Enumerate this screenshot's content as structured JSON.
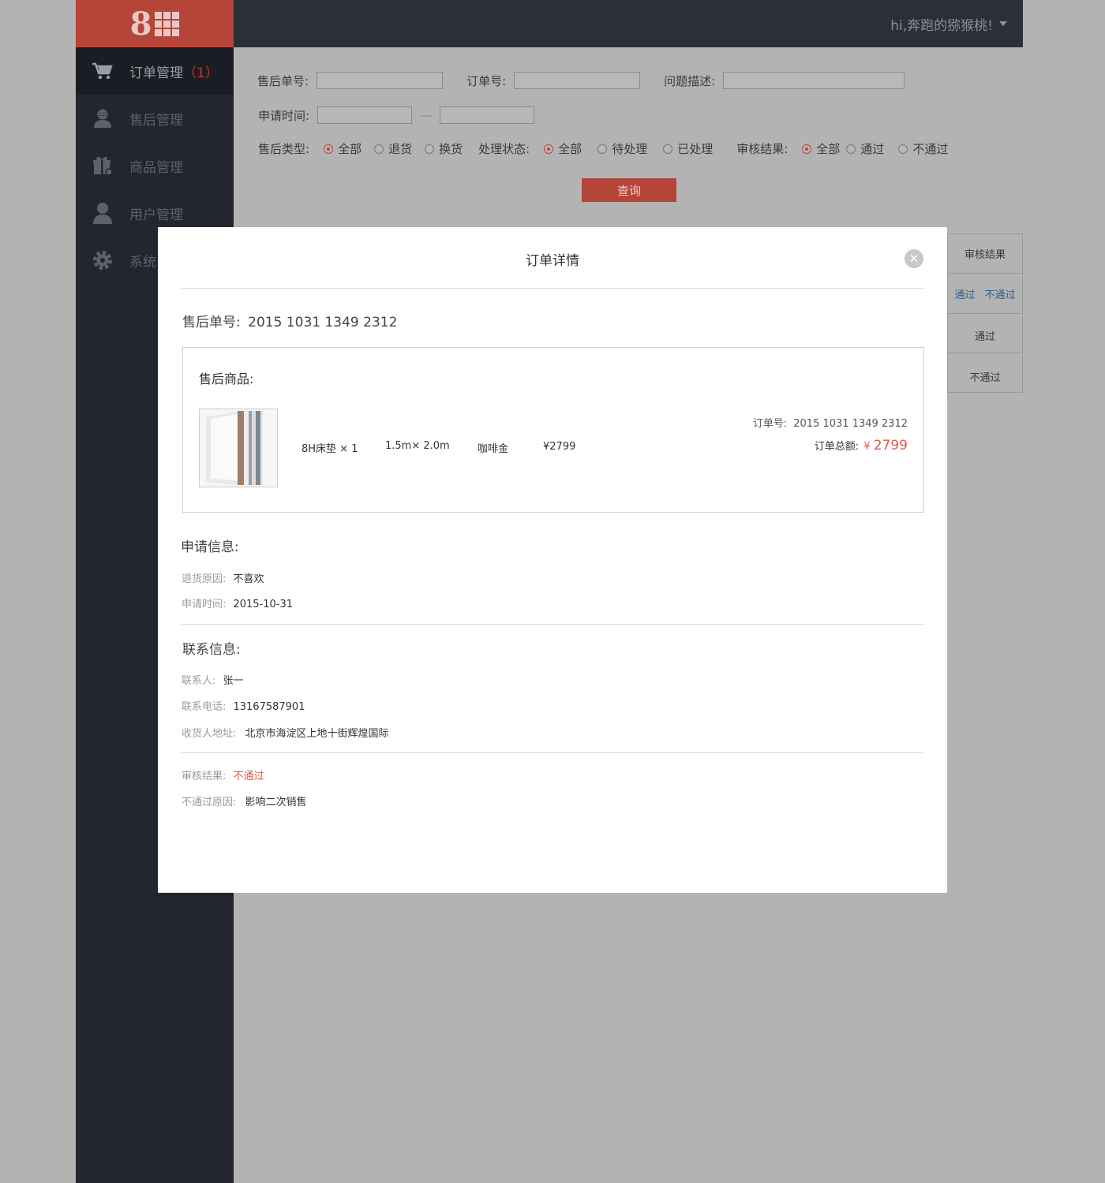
{
  "logo": {
    "text": "8"
  },
  "sidebar": {
    "items": [
      {
        "label": "订单管理",
        "badge": "（1）"
      },
      {
        "label": "售后管理"
      },
      {
        "label": "商品管理"
      },
      {
        "label": "用户管理"
      },
      {
        "label": "系统"
      }
    ]
  },
  "header": {
    "user_greeting": "hi,奔跑的猕猴桃!"
  },
  "filters": {
    "after_sale_no_label": "售后单号:",
    "order_no_label": "订单号:",
    "problem_desc_label": "问题描述:",
    "apply_time_label": "申请时间:",
    "range_sep": "—",
    "type_label": "售后类型:",
    "type_options": [
      "全部",
      "退货",
      "换货"
    ],
    "status_label": "处理状态:",
    "status_options": [
      "全部",
      "待处理",
      "已处理"
    ],
    "review_label": "审核结果:",
    "review_options": [
      "全部",
      "通过",
      "不通过"
    ],
    "query_button": "查询"
  },
  "table": {
    "header": "审核结果",
    "row1_pass": "通过",
    "row1_fail": "不通过",
    "row2": "通过",
    "row3": "不通过"
  },
  "modal": {
    "title": "订单详情",
    "close_glyph": "✕",
    "after_sale_label": "售后单号:",
    "after_sale_no": "2015 1031 1349 2312",
    "goods": {
      "heading": "售后商品:",
      "name": "8H床垫 × 1",
      "size": "1.5m× 2.0m",
      "color": "咖啡金",
      "price": "¥2799",
      "order_no_label": "订单号:",
      "order_no": "2015 1031 1349 2312",
      "total_label": "订单总额:",
      "total_currency": "¥",
      "total_value": "2799"
    },
    "apply": {
      "heading": "申请信息:",
      "reason_label": "退货原因:",
      "reason": "不喜欢",
      "time_label": "申请时间:",
      "time": "2015-10-31"
    },
    "contact": {
      "heading": "联系信息:",
      "person_label": "联系人:",
      "person": "张一",
      "phone_label": "联系电话:",
      "phone": "13167587901",
      "address_label": "收货人地址:",
      "address": "北京市海淀区上地十街辉煌国际"
    },
    "review": {
      "result_label": "审核结果:",
      "result": "不通过",
      "reason_label": "不通过原因:",
      "reason": "影响二次销售"
    }
  },
  "colors": {
    "accent": "#b54538",
    "sidebar": "#24262f",
    "topbar": "#2d2f38",
    "overlay": "#b3b3b3",
    "link": "#3b7dd8",
    "danger": "#e05a4a"
  }
}
